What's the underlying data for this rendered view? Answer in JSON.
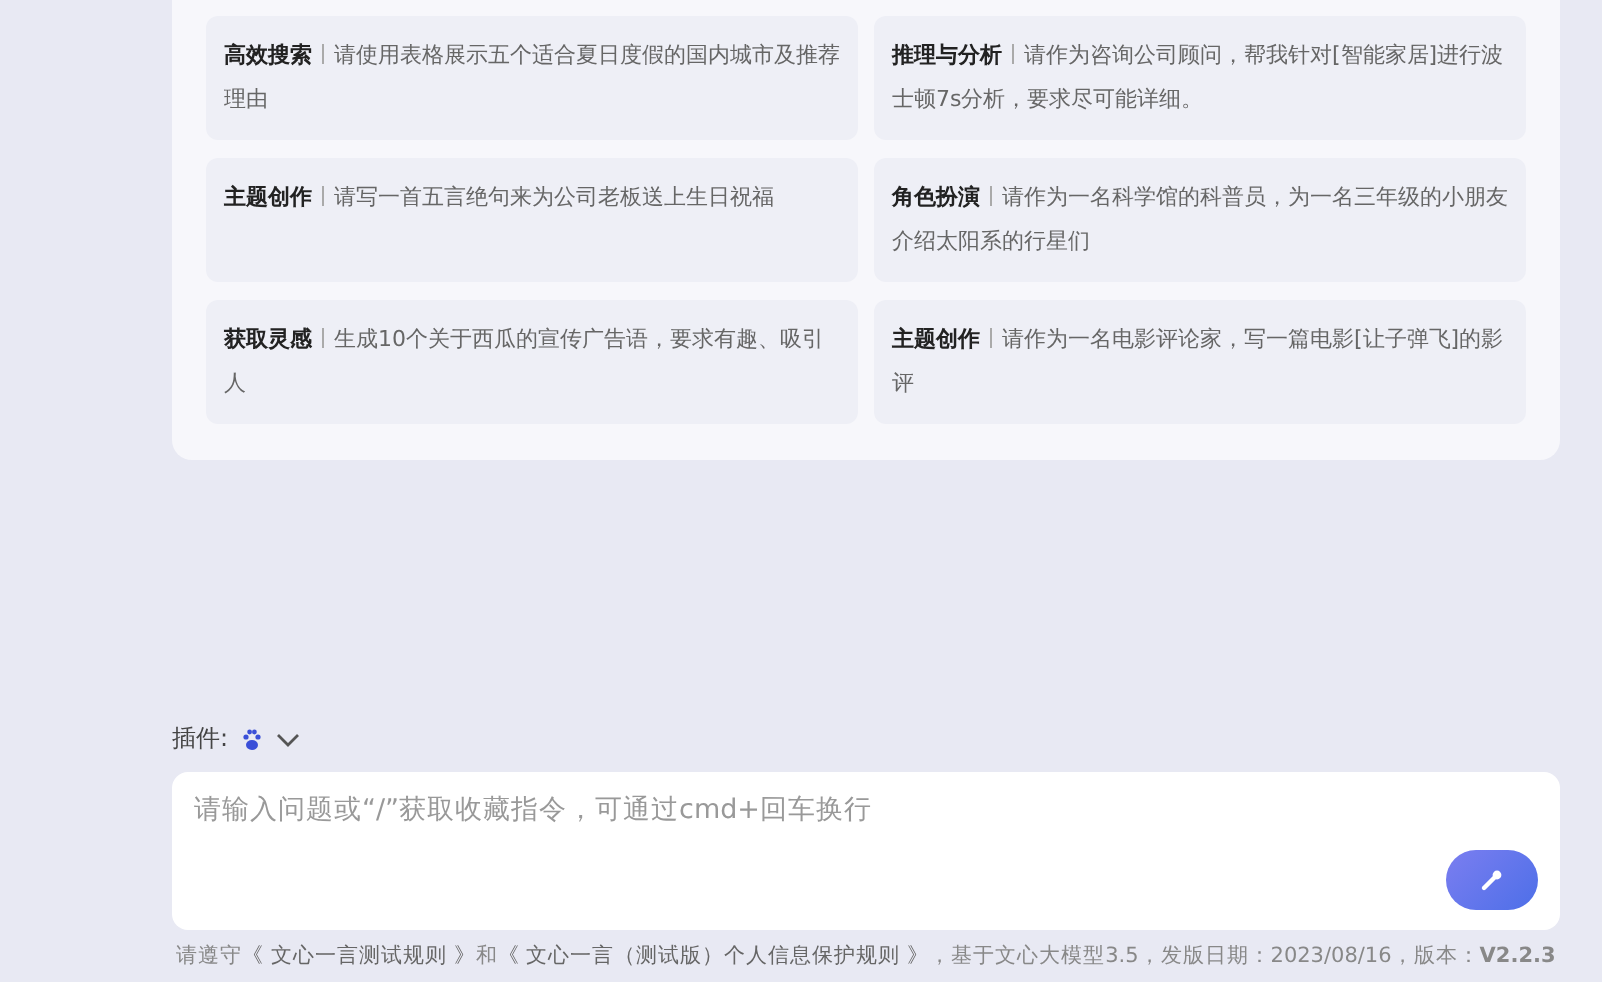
{
  "prompts": [
    {
      "category": "高效搜索",
      "text": "请使用表格展示五个适合夏日度假的国内城市及推荐理由"
    },
    {
      "category": "推理与分析",
      "text": "请作为咨询公司顾问，帮我针对[智能家居]进行波士顿7s分析，要求尽可能详细。"
    },
    {
      "category": "主题创作",
      "text": "请写一首五言绝句来为公司老板送上生日祝福"
    },
    {
      "category": "角色扮演",
      "text": "请作为一名科学馆的科普员，为一名三年级的小朋友介绍太阳系的行星们"
    },
    {
      "category": "获取灵感",
      "text": "生成10个关于西瓜的宣传广告语，要求有趣、吸引人"
    },
    {
      "category": "主题创作",
      "text": "请作为一名电影评论家，写一篇电影[让子弹飞]的影评"
    }
  ],
  "plugin": {
    "label": "插件:"
  },
  "input": {
    "placeholder": "请输入问题或“/”获取收藏指令，可通过cmd+回车换行"
  },
  "footer": [
    {
      "kind": "text",
      "text": "请遵守"
    },
    {
      "kind": "link",
      "text": "《 文心一言测试规则 》"
    },
    {
      "kind": "text",
      "text": "和"
    },
    {
      "kind": "link",
      "text": "《 文心一言（测试版）个人信息保护规则 》"
    },
    {
      "kind": "text",
      "text": "，基于文心大模型3.5，发版日期：2023/08/16，版本：**V2.2.3**"
    }
  ]
}
